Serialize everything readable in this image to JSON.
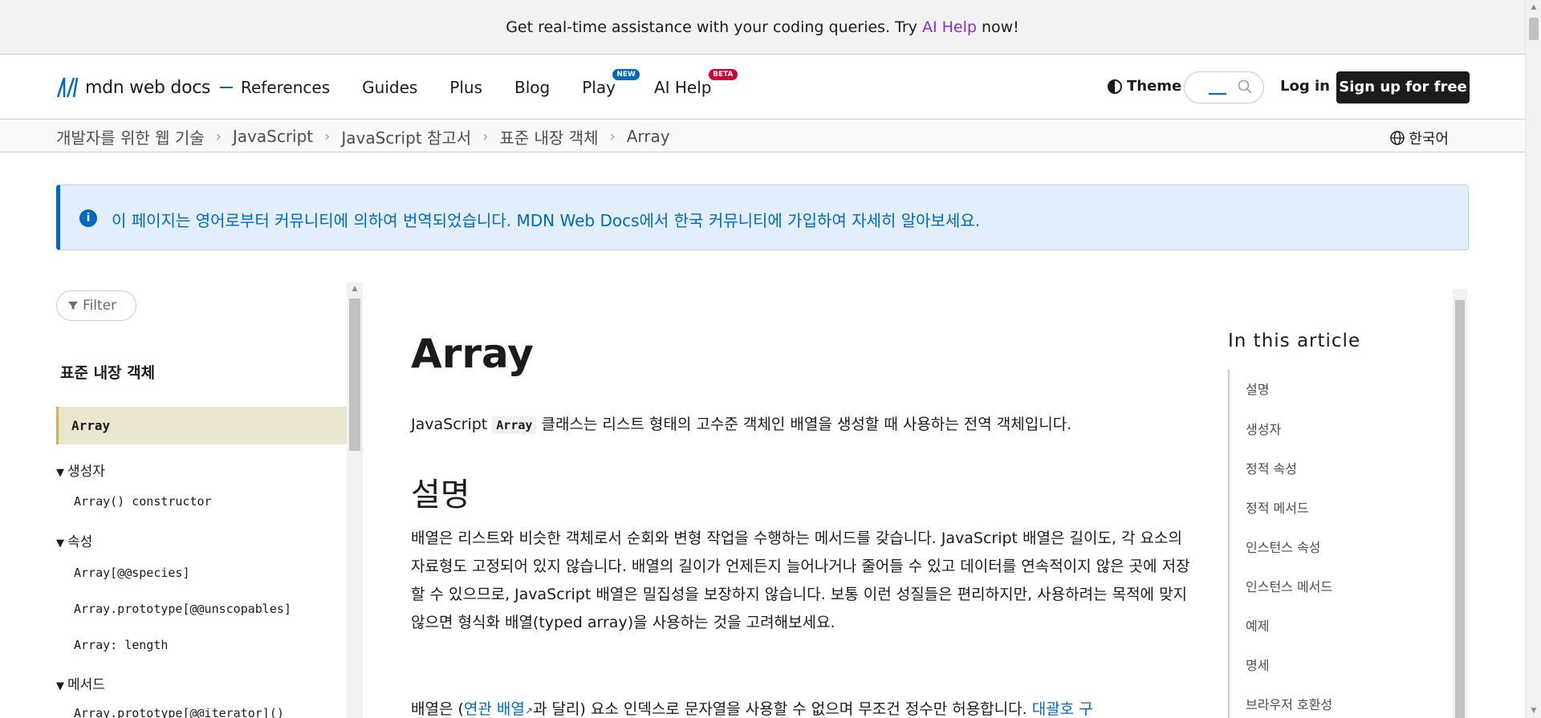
{
  "banner": {
    "text_before": "Get real-time assistance with your coding queries. Try ",
    "link": "AI Help",
    "text_after": " now!"
  },
  "nav": {
    "logo_text": "mdn web docs",
    "links": [
      "References",
      "Guides",
      "Plus",
      "Blog",
      "Play",
      "AI Help"
    ],
    "badges": {
      "play": "NEW",
      "ai_help": "BETA"
    },
    "theme": "Theme",
    "login": "Log in",
    "signup": "Sign up for free"
  },
  "breadcrumbs": [
    "개발자를 위한 웹 기술",
    "JavaScript",
    "JavaScript 참고서",
    "표준 내장 객체",
    "Array"
  ],
  "language": "한국어",
  "notice": {
    "before": "이 페이지는 영어로부터 커뮤니티에 의하여 번역되었습니다. ",
    "link": "MDN Web Docs에서 한국 커뮤니티에 가입하여 자세히 알아보세요."
  },
  "sidebar": {
    "filter": "Filter",
    "heading": "표준 내장 객체",
    "active": "Array",
    "groups": [
      "생성자",
      "속성",
      "메서드"
    ],
    "items": [
      "Array() constructor",
      "Array[@@species]",
      "Array.prototype[@@unscopables]",
      "Array: length",
      "Array.prototype[@@iterator]()"
    ]
  },
  "article": {
    "title": "Array",
    "intro_before": "JavaScript ",
    "intro_code": "Array",
    "intro_after": " 클래스는 리스트 형태의 고수준 객체인 배열을 생성할 때 사용하는 전역 객체입니다.",
    "h2": "설명",
    "para": "배열은 리스트와 비슷한 객체로서 순회와 변형 작업을 수행하는 메서드를 갖습니다. JavaScript 배열은 길이도, 각 요소의 자료형도 고정되어 있지 않습니다. 배열의 길이가 언제든지 늘어나거나 줄어들 수 있고 데이터를 연속적이지 않은 곳에 저장할 수 있으므로, JavaScript 배열은 밀집성을 보장하지 않습니다. 보통 이런 성질들은 편리하지만, 사용하려는 목적에 맞지 않으면 형식화 배열(typed array)을 사용하는 것을 고려해보세요.",
    "para2_before": "배열은 (",
    "para2_link": "연관 배열",
    "para2_mid": "과 달리) 요소 인덱스로 문자열을 사용할 수 없으며 무조건 정수만 허용합니다. ",
    "para2_link2": "대괄호 구"
  },
  "toc": {
    "title": "In this article",
    "items": [
      "설명",
      "생성자",
      "정적 속성",
      "정적 메서드",
      "인스턴스 속성",
      "인스턴스 메서드",
      "예제",
      "명세",
      "브라우저 호환성"
    ]
  }
}
